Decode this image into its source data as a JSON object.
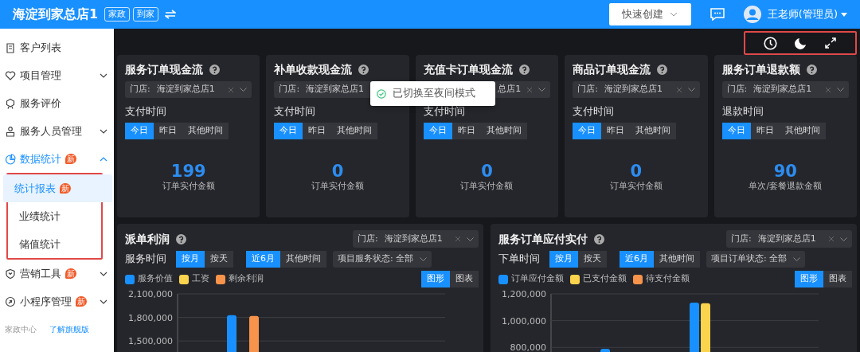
{
  "header": {
    "title": "海淀到家总店1",
    "tags": [
      "家政",
      "到家"
    ],
    "quick_create": "快速创建",
    "user": "王老师(管理员)"
  },
  "sidebar": {
    "items": [
      {
        "label": "客户列表",
        "selected": false
      },
      {
        "label": "项目管理",
        "expanded": false,
        "selected": false
      },
      {
        "label": "服务评价",
        "selected": false
      },
      {
        "label": "服务人员管理",
        "expanded": false,
        "selected": false
      },
      {
        "label": "数据统计",
        "badge": "新",
        "expanded": true,
        "selected": false,
        "children": [
          {
            "label": "统计报表",
            "badge": "新",
            "selected": true
          },
          {
            "label": "业绩统计",
            "selected": false
          },
          {
            "label": "储值统计",
            "selected": false
          }
        ]
      },
      {
        "label": "营销工具",
        "badge": "新",
        "expanded": false,
        "selected": false
      },
      {
        "label": "小程序管理",
        "badge": "新",
        "expanded": false,
        "selected": false
      }
    ],
    "footer": {
      "text": "家政中心",
      "link": "了解旗舰版"
    }
  },
  "toast": {
    "message": "已切换至夜间模式"
  },
  "metric_cards": [
    {
      "title": "服务订单现金流",
      "store_label": "门店:",
      "store_value": "海淀到家总店1",
      "time_label": "支付时间",
      "time_options": [
        {
          "label": "今日",
          "selected": true
        },
        {
          "label": "昨日",
          "selected": false
        },
        {
          "label": "其他时间",
          "selected": false
        }
      ],
      "value": "199",
      "caption": "订单实付金额"
    },
    {
      "title": "补单收款现金流",
      "store_label": "门店:",
      "store_value": "海淀到家总店1",
      "time_label": "支付时间",
      "time_options": [
        {
          "label": "今日",
          "selected": true
        },
        {
          "label": "昨日",
          "selected": false
        },
        {
          "label": "其他时间",
          "selected": false
        }
      ],
      "value": "0",
      "caption": "订单实付金额"
    },
    {
      "title": "充值卡订单现金流",
      "store_value": "总店1",
      "time_label": "支付时间",
      "time_options": [
        {
          "label": "今日",
          "selected": true
        },
        {
          "label": "昨日",
          "selected": false
        },
        {
          "label": "其他时间",
          "selected": false
        }
      ],
      "value": "0",
      "caption": "订单实付金额"
    },
    {
      "title": "商品订单现金流",
      "store_label": "门店:",
      "store_value": "海淀到家总店1",
      "time_label": "支付时间",
      "time_options": [
        {
          "label": "今日",
          "selected": true
        },
        {
          "label": "昨日",
          "selected": false
        },
        {
          "label": "其他时间",
          "selected": false
        }
      ],
      "value": "0",
      "caption": "订单实付金额"
    },
    {
      "title": "服务订单退款额",
      "store_label": "门店:",
      "store_value": "海淀到家总店1",
      "time_label": "退款时间",
      "time_options": [
        {
          "label": "今日",
          "selected": true
        },
        {
          "label": "昨日",
          "selected": false
        },
        {
          "label": "其他时间",
          "selected": false
        }
      ],
      "value": "90",
      "caption": "单次/套餐退款金额"
    }
  ],
  "chart_cards": [
    {
      "title": "派单利润",
      "store_label": "门店:",
      "store_value": "海淀到家总店1",
      "time_label": "服务时间",
      "unit_options": [
        {
          "label": "按月",
          "selected": true
        },
        {
          "label": "按天",
          "selected": false
        }
      ],
      "range_options": [
        {
          "label": "近6月",
          "selected": true
        },
        {
          "label": "其他时间",
          "selected": false
        }
      ],
      "status_filter": "项目服务状态: 全部",
      "view_options": [
        {
          "label": "图形",
          "selected": true
        },
        {
          "label": "图表",
          "selected": false
        }
      ],
      "chart_data": {
        "type": "bar",
        "ylim": [
          1350000,
          2100000
        ],
        "yticks": [
          {
            "value": 1500000,
            "label": "1,500,000"
          },
          {
            "value": 1800000,
            "label": "1,800,000"
          },
          {
            "value": 2100000,
            "label": "2,100,000"
          }
        ],
        "series": [
          {
            "name": "服务价值",
            "color": "#1890ff",
            "values": [
              null,
              1830000,
              null,
              null,
              null,
              null
            ]
          },
          {
            "name": "工资",
            "color": "#fcd34d",
            "values": [
              null,
              null,
              null,
              null,
              null,
              null
            ]
          },
          {
            "name": "剩余利润",
            "color": "#f7934a",
            "values": [
              null,
              1820000,
              null,
              null,
              null,
              null
            ]
          }
        ]
      }
    },
    {
      "title": "服务订单应付实付",
      "store_label": "门店:",
      "store_value": "海淀到家总店1",
      "time_label": "下单时间",
      "unit_options": [
        {
          "label": "按月",
          "selected": true
        },
        {
          "label": "按天",
          "selected": false
        }
      ],
      "range_options": [
        {
          "label": "近6月",
          "selected": true
        },
        {
          "label": "其他时间",
          "selected": false
        }
      ],
      "status_filter": "项目订单状态: 全部",
      "view_options": [
        {
          "label": "图形",
          "selected": true
        },
        {
          "label": "图表",
          "selected": false
        }
      ],
      "chart_data": {
        "type": "bar",
        "ylim": [
          760000,
          1200000
        ],
        "yticks": [
          {
            "value": 800000,
            "label": "800,000"
          },
          {
            "value": 1000000,
            "label": "1,000,000"
          },
          {
            "value": 1200000,
            "label": "1,200,000"
          }
        ],
        "series": [
          {
            "name": "订单应付金额",
            "color": "#1890ff",
            "values": [
              null,
              790000,
              null,
              1135000,
              null,
              null
            ]
          },
          {
            "name": "已支付金额",
            "color": "#fcd34d",
            "values": [
              null,
              null,
              null,
              1130000,
              null,
              null
            ]
          },
          {
            "name": "待支付金额",
            "color": "#f7934a",
            "values": [
              null,
              null,
              null,
              null,
              null,
              null
            ]
          }
        ]
      }
    }
  ]
}
